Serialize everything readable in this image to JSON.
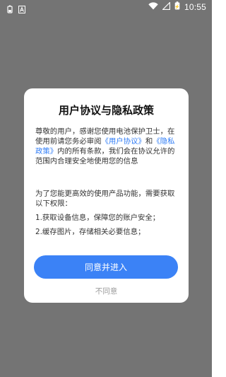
{
  "status_bar": {
    "time": "10:55",
    "icons": [
      "battery-saver-icon",
      "font-icon",
      "wifi-icon",
      "signal-icon",
      "battery-icon"
    ]
  },
  "dialog": {
    "title": "用户协议与隐私政策",
    "para1_lead": "尊敬的用户，感谢您使用电池保护卫士，在使用前请您务必审阅",
    "link_user_agreement": "《用户协议》",
    "para1_and": "和",
    "link_privacy_policy": "《隐私政策》",
    "para1_tail": "内的所有条款，我们会在协议允许的范围内合理安全地使用您的信息",
    "para2_lead": "为了您能更高效的使用产品功能，需要获取以下权限：",
    "permissions": [
      "1.获取设备信息，保障您的账户安全；",
      "2.缓存图片，存储相关必要信息；"
    ],
    "agree_label": "同意并进入",
    "disagree_label": "不同意"
  },
  "colors": {
    "overlay": "#747474",
    "link": "#2f7cf6",
    "primary_button": "#3b82f6"
  }
}
